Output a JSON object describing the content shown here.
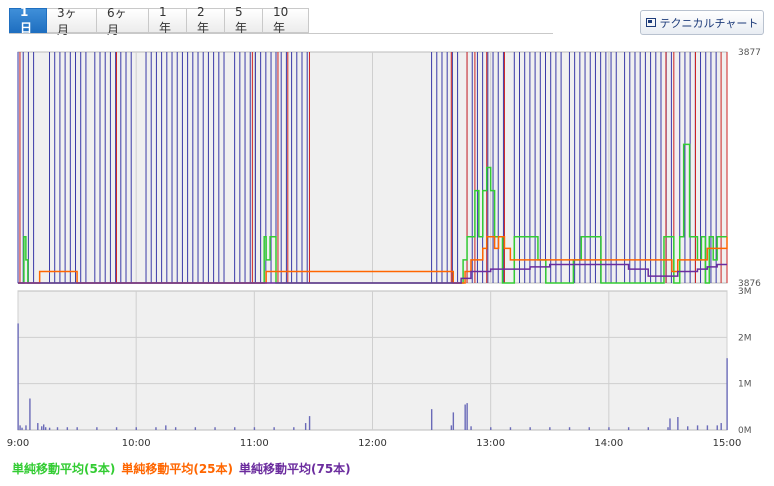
{
  "tabs": [
    {
      "label": "1日",
      "active": true
    },
    {
      "label": "3ヶ月",
      "active": false
    },
    {
      "label": "6ヶ月",
      "active": false
    },
    {
      "label": "1年",
      "active": false
    },
    {
      "label": "2年",
      "active": false
    },
    {
      "label": "5年",
      "active": false
    },
    {
      "label": "10年",
      "active": false
    }
  ],
  "technical_button": {
    "label": "テクニカルチャート",
    "icon": "chart-window-icon"
  },
  "colors": {
    "price": "#3a3aa8",
    "price_up": "#cc2222",
    "ma5": "#33cc33",
    "ma25": "#ff6600",
    "ma75": "#6b2c9e",
    "volume": "#6a6ab8",
    "grid": "#cfcfcf",
    "plot_bg": "#f0f0f0"
  },
  "legend": [
    {
      "label": "単純移動平均(5本)",
      "color": "#33cc33"
    },
    {
      "label": "単純移動平均(25本)",
      "color": "#ff6600"
    },
    {
      "label": "単純移動平均(75本)",
      "color": "#6b2c9e"
    }
  ],
  "chart_data": [
    {
      "type": "line",
      "title": "",
      "xlabel": "",
      "ylabel": "",
      "ylim": [
        3876,
        3877
      ],
      "y_ticks": [
        "3877",
        "3876"
      ],
      "grid": true,
      "x_ticks": [
        "9:00",
        "10:00",
        "11:00",
        "12:00",
        "13:00",
        "14:00",
        "15:00"
      ],
      "price_oscillation": {
        "series_name": "",
        "low": 3876,
        "high": 3877,
        "active_periods": [
          {
            "start": "9:00",
            "end": "9:09"
          },
          {
            "start": "9:16",
            "end": "9:37"
          },
          {
            "start": "9:39",
            "end": "10:00"
          },
          {
            "start": "10:05",
            "end": "10:45"
          },
          {
            "start": "10:50",
            "end": "11:11"
          },
          {
            "start": "11:11",
            "end": "11:28"
          },
          {
            "start": "12:30",
            "end": "12:44"
          },
          {
            "start": "12:48",
            "end": "13:09"
          },
          {
            "start": "13:12",
            "end": "13:36"
          },
          {
            "start": "13:40",
            "end": "14:06"
          },
          {
            "start": "14:08",
            "end": "14:34"
          },
          {
            "start": "14:36",
            "end": "14:57"
          }
        ],
        "up_ticks": [
          "9:01",
          "9:50",
          "10:59",
          "11:12",
          "11:17",
          "11:28",
          "12:40",
          "12:48",
          "12:52",
          "12:58",
          "13:07",
          "14:29",
          "14:33",
          "14:44",
          "14:57",
          "15:00"
        ]
      },
      "series": [
        {
          "name": "単純移動平均(5本)",
          "x": [
            "9:00",
            "9:02",
            "9:03",
            "9:04",
            "9:05",
            "9:06",
            "9:07",
            "9:08",
            "9:09",
            "9:15",
            "9:40",
            "10:00",
            "10:30",
            "11:00",
            "11:04",
            "11:05",
            "11:06",
            "11:08",
            "11:10",
            "11:11",
            "11:12",
            "11:30",
            "12:00",
            "12:30",
            "12:40",
            "12:44",
            "12:46",
            "12:48",
            "12:50",
            "12:52",
            "12:54",
            "12:56",
            "12:58",
            "13:00",
            "13:02",
            "13:04",
            "13:06",
            "13:10",
            "13:12",
            "13:16",
            "13:20",
            "13:24",
            "13:28",
            "13:36",
            "13:40",
            "13:42",
            "13:46",
            "13:50",
            "13:56",
            "14:00",
            "14:10",
            "14:20",
            "14:28",
            "14:30",
            "14:33",
            "14:36",
            "14:38",
            "14:41",
            "14:43",
            "14:45",
            "14:47",
            "14:49",
            "14:51",
            "14:53",
            "14:55",
            "14:57",
            "15:00"
          ],
          "y": [
            3876.0,
            3876.0,
            3876.2,
            3876.1,
            3876.0,
            3876.0,
            3876.0,
            3876.0,
            3876.0,
            3876.0,
            3876.0,
            3876.0,
            3876.0,
            3876.0,
            3876.0,
            3876.2,
            3876.1,
            3876.2,
            3876.2,
            3876.0,
            3876.0,
            3876.0,
            3876.0,
            3876.0,
            3876.0,
            3876.0,
            3876.1,
            3876.2,
            3876.2,
            3876.4,
            3876.2,
            3876.4,
            3876.5,
            3876.4,
            3876.2,
            3876.2,
            3876.0,
            3876.0,
            3876.2,
            3876.2,
            3876.2,
            3876.1,
            3876.0,
            3876.0,
            3876.0,
            3876.1,
            3876.2,
            3876.2,
            3876.0,
            3876.0,
            3876.0,
            3876.0,
            3876.2,
            3876.2,
            3876.0,
            3876.2,
            3876.6,
            3876.2,
            3876.2,
            3876.1,
            3876.2,
            3876.0,
            3876.2,
            3876.1,
            3876.2,
            3876.2,
            3876.2
          ]
        },
        {
          "name": "単純移動平均(25本)",
          "x": [
            "9:00",
            "9:06",
            "9:09",
            "9:11",
            "9:30",
            "10:00",
            "11:00",
            "11:06",
            "11:07",
            "11:30",
            "12:00",
            "12:30",
            "12:40",
            "12:41",
            "12:47",
            "12:50",
            "12:56",
            "12:58",
            "13:00",
            "13:02",
            "13:04",
            "13:07",
            "13:10",
            "13:16",
            "13:22",
            "13:30",
            "13:36",
            "13:40",
            "13:50",
            "14:00",
            "14:10",
            "14:20",
            "14:28",
            "14:32",
            "14:35",
            "14:40",
            "14:45",
            "14:50",
            "14:55",
            "15:00"
          ],
          "y": [
            3876.0,
            3876.0,
            3876.0,
            3876.05,
            3876.0,
            3876.0,
            3876.0,
            3876.05,
            3876.05,
            3876.05,
            3876.05,
            3876.05,
            3876.05,
            3876.0,
            3876.05,
            3876.1,
            3876.15,
            3876.2,
            3876.2,
            3876.15,
            3876.2,
            3876.15,
            3876.1,
            3876.1,
            3876.1,
            3876.1,
            3876.1,
            3876.1,
            3876.1,
            3876.1,
            3876.1,
            3876.1,
            3876.1,
            3876.05,
            3876.1,
            3876.1,
            3876.1,
            3876.15,
            3876.15,
            3876.2
          ]
        },
        {
          "name": "単純移動平均(75本)",
          "x": [
            "9:00",
            "9:30",
            "10:00",
            "10:10",
            "10:30",
            "11:00",
            "11:10",
            "11:30",
            "12:00",
            "12:30",
            "12:40",
            "12:45",
            "12:50",
            "13:00",
            "13:10",
            "13:20",
            "13:30",
            "13:40",
            "13:50",
            "14:00",
            "14:10",
            "14:20",
            "14:28",
            "14:35",
            "14:40",
            "14:45",
            "14:50",
            "14:55",
            "15:00"
          ],
          "y": [
            3876.0,
            3876.0,
            3876.0,
            3876.0,
            3876.0,
            3876.0,
            3876.0,
            3876.0,
            3876.0,
            3876.0,
            3876.0,
            3876.02,
            3876.05,
            3876.06,
            3876.06,
            3876.07,
            3876.08,
            3876.08,
            3876.08,
            3876.08,
            3876.06,
            3876.03,
            3876.03,
            3876.05,
            3876.05,
            3876.06,
            3876.07,
            3876.08,
            3876.08
          ]
        }
      ]
    },
    {
      "type": "bar",
      "title": "",
      "xlabel": "",
      "ylabel": "",
      "ylim": [
        0,
        3000000
      ],
      "y_ticks": [
        "3M",
        "2M",
        "1M",
        "0M"
      ],
      "grid": true,
      "x_ticks": [
        "9:00",
        "10:00",
        "11:00",
        "12:00",
        "13:00",
        "14:00",
        "15:00"
      ],
      "series": [
        {
          "name": "",
          "x": [
            "9:00",
            "9:01",
            "9:02",
            "9:04",
            "9:06",
            "9:10",
            "9:12",
            "9:13",
            "9:14",
            "9:16",
            "9:20",
            "9:25",
            "9:30",
            "9:40",
            "9:50",
            "10:00",
            "10:10",
            "10:15",
            "10:20",
            "10:30",
            "10:40",
            "10:50",
            "11:00",
            "11:10",
            "11:20",
            "11:26",
            "11:28",
            "12:30",
            "12:40",
            "12:41",
            "12:47",
            "12:48",
            "12:50",
            "13:00",
            "13:10",
            "13:20",
            "13:30",
            "13:40",
            "13:50",
            "14:00",
            "14:10",
            "14:20",
            "14:30",
            "14:31",
            "14:35",
            "14:40",
            "14:45",
            "14:50",
            "14:55",
            "14:57",
            "15:00"
          ],
          "values": [
            2300000,
            100000,
            50000,
            100000,
            680000,
            150000,
            80000,
            120000,
            60000,
            50000,
            60000,
            60000,
            60000,
            60000,
            60000,
            60000,
            60000,
            100000,
            60000,
            60000,
            60000,
            60000,
            60000,
            60000,
            60000,
            150000,
            300000,
            450000,
            100000,
            380000,
            550000,
            580000,
            80000,
            60000,
            60000,
            60000,
            60000,
            60000,
            60000,
            60000,
            60000,
            60000,
            60000,
            250000,
            280000,
            80000,
            100000,
            100000,
            100000,
            150000,
            1550000
          ]
        }
      ]
    }
  ]
}
